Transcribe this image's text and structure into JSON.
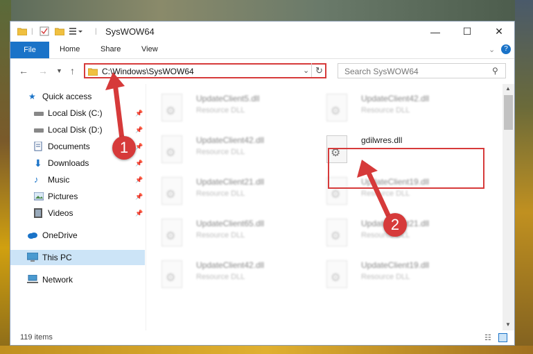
{
  "window": {
    "title": "SysWOW64",
    "controls": {
      "minimize": "—",
      "maximize": "☐",
      "close": "✕"
    }
  },
  "ribbon": {
    "tabs": [
      "File",
      "Home",
      "Share",
      "View"
    ],
    "collapse_icon": "chevron-up-icon",
    "help_icon": "help-icon"
  },
  "navigation": {
    "address": "C:\\Windows\\SysWOW64",
    "search_placeholder": "Search SysWOW64"
  },
  "sidebar": {
    "items": [
      {
        "label": "Quick access",
        "icon": "star-icon"
      },
      {
        "label": "Local Disk (C:)",
        "icon": "drive-icon",
        "pinned": true
      },
      {
        "label": "Local Disk (D:)",
        "icon": "drive-icon",
        "pinned": true
      },
      {
        "label": "Documents",
        "icon": "documents-icon",
        "pinned": true
      },
      {
        "label": "Downloads",
        "icon": "download-icon",
        "pinned": true
      },
      {
        "label": "Music",
        "icon": "music-icon",
        "pinned": true
      },
      {
        "label": "Pictures",
        "icon": "pictures-icon",
        "pinned": true
      },
      {
        "label": "Videos",
        "icon": "videos-icon",
        "pinned": true
      },
      {
        "label": "OneDrive",
        "icon": "cloud-icon"
      },
      {
        "label": "This PC",
        "icon": "computer-icon",
        "selected": true
      },
      {
        "label": "Network",
        "icon": "network-icon"
      }
    ]
  },
  "files": [
    {
      "name": "UpdateClient5.dll",
      "type": "Resource DLL"
    },
    {
      "name": "UpdateClient42.dll",
      "type": "Resource DLL"
    },
    {
      "name": "UpdateClient42.dll",
      "type": "Resource DLL"
    },
    {
      "name": "gdilwres.dll",
      "type": ""
    },
    {
      "name": "UpdateClient21.dll",
      "type": "Resource DLL"
    },
    {
      "name": "UpdateClient19.dll",
      "type": "Resource DLL"
    },
    {
      "name": "UpdateClient65.dll",
      "type": "Resource DLL"
    },
    {
      "name": "UpdateClient21.dll",
      "type": "Resource DLL"
    },
    {
      "name": "UpdateClient42.dll",
      "type": "Resource DLL"
    },
    {
      "name": "UpdateClient19.dll",
      "type": "Resource DLL"
    }
  ],
  "annotations": {
    "step1": "1",
    "step2": "2"
  },
  "status": {
    "item_count": "119 items"
  },
  "colors": {
    "accent": "#1a73c8",
    "highlight": "#d63a3a",
    "selected": "#cce4f7"
  }
}
